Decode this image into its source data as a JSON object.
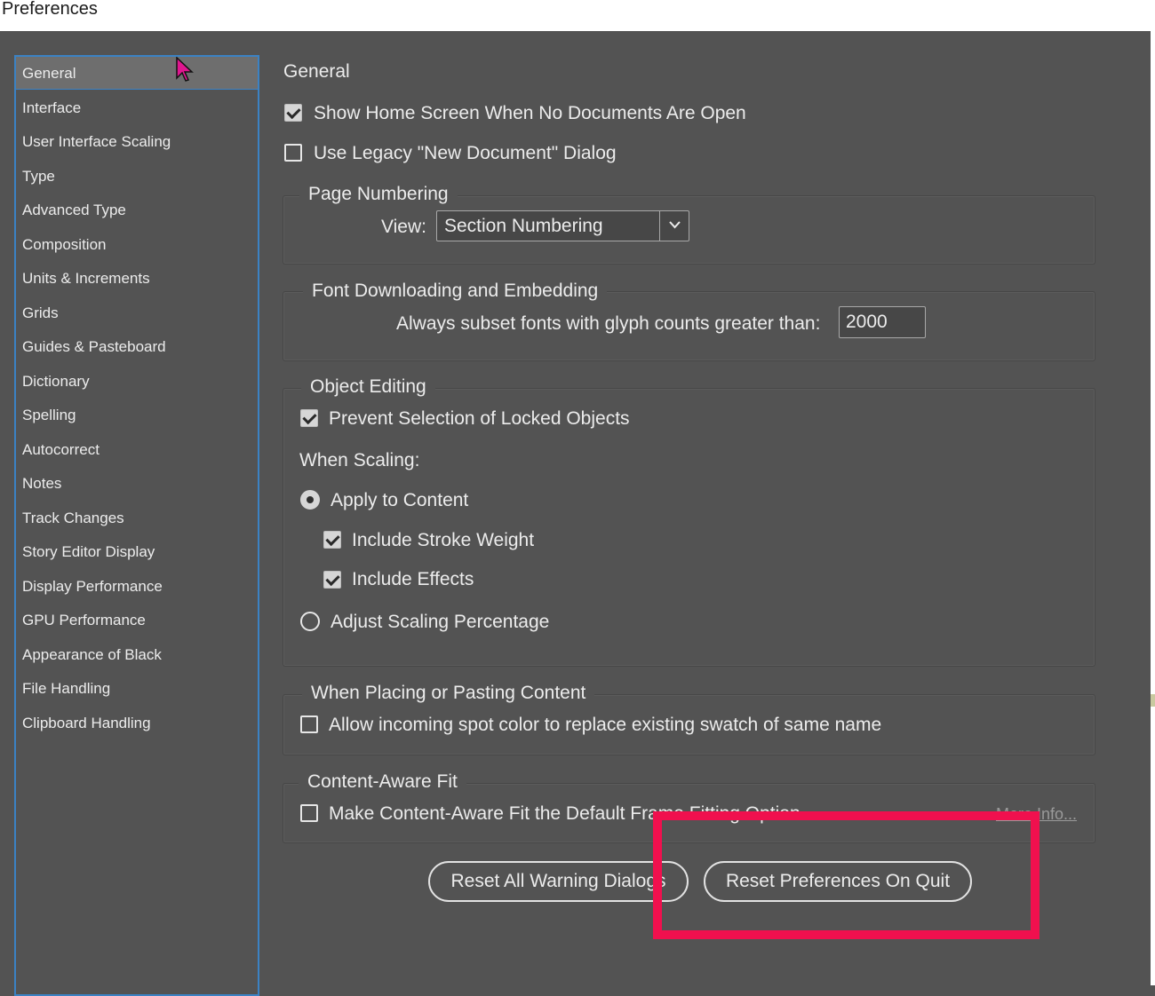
{
  "window": {
    "title": "Preferences"
  },
  "sidebar": {
    "items": [
      {
        "label": "General",
        "selected": true
      },
      {
        "label": "Interface"
      },
      {
        "label": "User Interface Scaling"
      },
      {
        "label": "Type"
      },
      {
        "label": "Advanced Type"
      },
      {
        "label": "Composition"
      },
      {
        "label": "Units & Increments"
      },
      {
        "label": "Grids"
      },
      {
        "label": "Guides & Pasteboard"
      },
      {
        "label": "Dictionary"
      },
      {
        "label": "Spelling"
      },
      {
        "label": "Autocorrect"
      },
      {
        "label": "Notes"
      },
      {
        "label": "Track Changes"
      },
      {
        "label": "Story Editor Display"
      },
      {
        "label": "Display Performance"
      },
      {
        "label": "GPU Performance"
      },
      {
        "label": "Appearance of Black"
      },
      {
        "label": "File Handling"
      },
      {
        "label": "Clipboard Handling"
      }
    ]
  },
  "main": {
    "title": "General",
    "show_home_screen": {
      "label": "Show Home Screen When No Documents Are Open",
      "checked": true
    },
    "use_legacy_dialog": {
      "label": "Use Legacy \"New Document\" Dialog",
      "checked": false
    },
    "page_numbering": {
      "legend": "Page Numbering",
      "view_label": "View:",
      "view_value": "Section Numbering"
    },
    "font_downloading": {
      "legend": "Font Downloading and Embedding",
      "subset_label": "Always subset fonts with glyph counts greater than:",
      "subset_value": "2000"
    },
    "object_editing": {
      "legend": "Object Editing",
      "prevent_selection": {
        "label": "Prevent Selection of Locked Objects",
        "checked": true
      },
      "when_scaling_label": "When Scaling:",
      "apply_to_content": {
        "label": "Apply to Content",
        "selected": true
      },
      "include_stroke_weight": {
        "label": "Include Stroke Weight",
        "checked": true
      },
      "include_effects": {
        "label": "Include Effects",
        "checked": true
      },
      "adjust_scaling": {
        "label": "Adjust Scaling Percentage",
        "selected": false
      }
    },
    "placing_pasting": {
      "legend": "When Placing or Pasting Content",
      "allow_spot_color": {
        "label": "Allow incoming spot color to replace existing swatch of same name",
        "checked": false
      }
    },
    "content_aware_fit": {
      "legend": "Content-Aware Fit",
      "make_default": {
        "label": "Make Content-Aware Fit the Default Frame Fitting Option",
        "checked": false
      },
      "more_info": "More Info..."
    },
    "buttons": {
      "reset_warnings": "Reset All Warning Dialogs",
      "reset_prefs": "Reset Preferences On Quit"
    }
  },
  "colors": {
    "highlight": "#f0104e",
    "cursor": "#e0168f",
    "selection_border": "#3b82c4"
  }
}
